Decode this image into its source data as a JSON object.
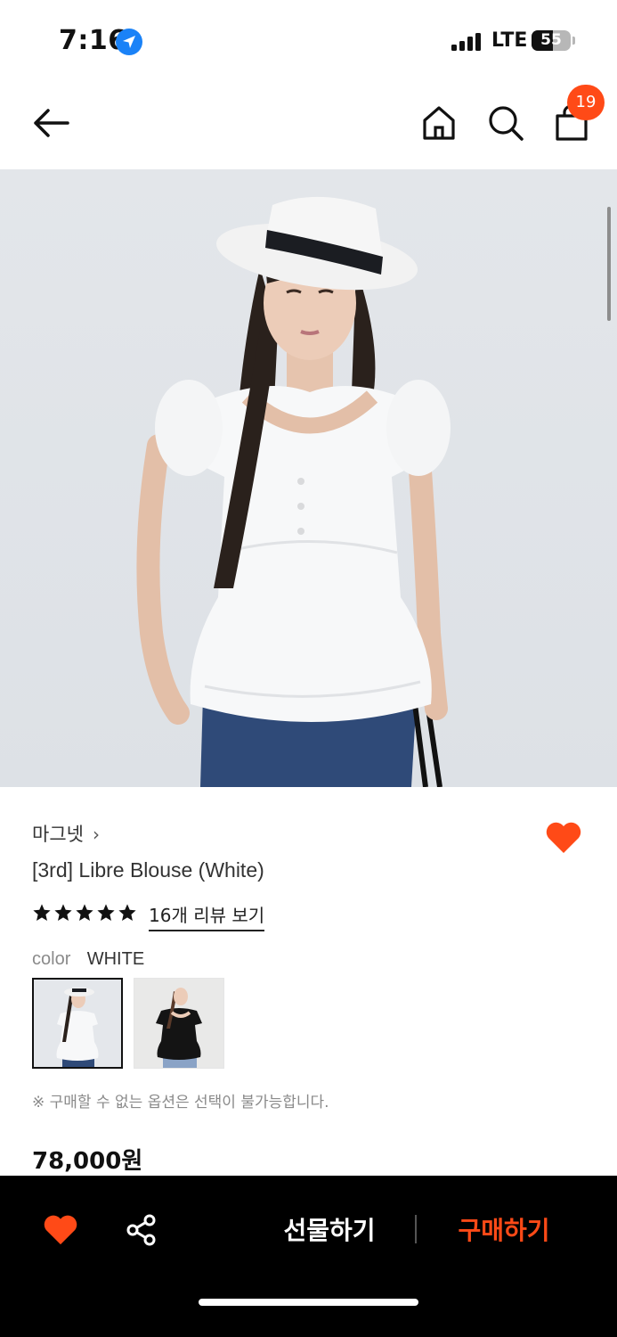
{
  "status_bar": {
    "time": "7:16",
    "network": "LTE",
    "battery_level": "55",
    "battery_fraction": 0.55
  },
  "header": {
    "cart_count": "19"
  },
  "product": {
    "brand": "마그넷",
    "name": "[3rd] Libre Blouse (White)",
    "rating_stars": 5,
    "review_link": "16개 리뷰 보기",
    "color_label": "color",
    "color_value": "WHITE",
    "swatches": [
      "white-option",
      "black-option"
    ],
    "notice": "※ 구매할 수 없는 옵션은 선택이 불가능합니다.",
    "price": "78,000원"
  },
  "bottom_bar": {
    "gift_label": "선물하기",
    "buy_label": "구매하기"
  },
  "colors": {
    "accent": "#ff4a17",
    "bottom_bar": "#000000",
    "location_blue": "#1a82f7"
  },
  "icons": [
    "location-icon",
    "signal-icon",
    "battery-icon",
    "back-arrow-icon",
    "home-icon",
    "search-icon",
    "bag-icon",
    "heart-icon",
    "star-icon",
    "share-icon"
  ]
}
